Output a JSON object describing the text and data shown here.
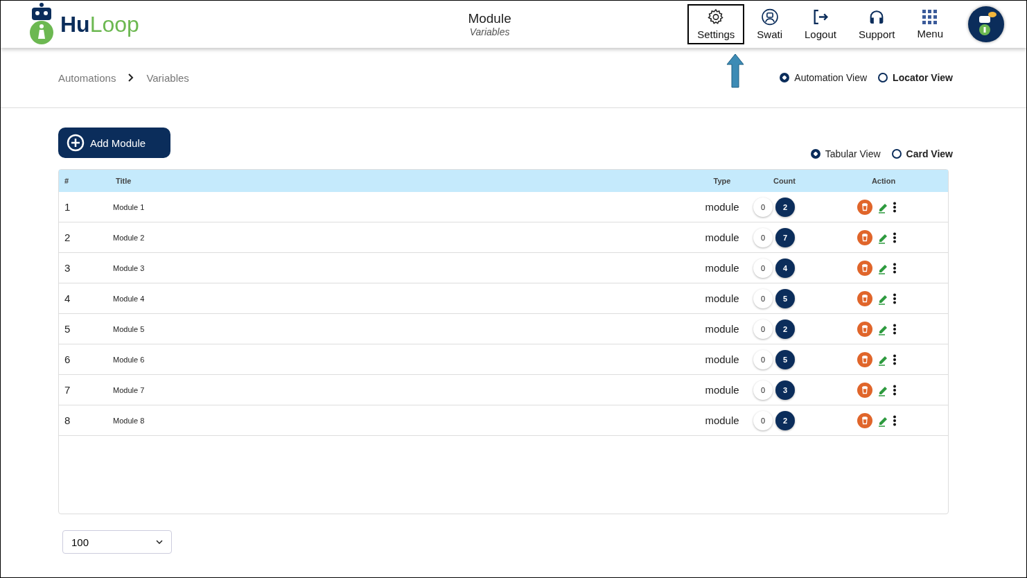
{
  "header": {
    "logo": {
      "dark": "Hu",
      "light": "Loop"
    },
    "title": "Module",
    "subtitle": "Variables",
    "nav": [
      {
        "label": "Settings",
        "kind": "gear",
        "highlighted": true
      },
      {
        "label": "Swati",
        "kind": "user",
        "highlighted": false
      },
      {
        "label": "Logout",
        "kind": "logout",
        "highlighted": false
      },
      {
        "label": "Support",
        "kind": "headset",
        "highlighted": false
      },
      {
        "label": "Menu",
        "kind": "grid",
        "highlighted": false
      }
    ]
  },
  "breadcrumb": [
    "Automations",
    "Variables"
  ],
  "view_modes": [
    {
      "label": "Automation View",
      "selected": true
    },
    {
      "label": "Locator View",
      "selected": false
    }
  ],
  "add_button": "Add Module",
  "layout_modes": [
    {
      "label": "Tabular View",
      "selected": true
    },
    {
      "label": "Card View",
      "selected": false
    }
  ],
  "table": {
    "columns": [
      "#",
      "Title",
      "Type",
      "Count",
      "Action"
    ],
    "rows": [
      {
        "index": "1",
        "title": "Module 1",
        "type": "module",
        "count_a": "0",
        "count_b": "2"
      },
      {
        "index": "2",
        "title": "Module 2",
        "type": "module",
        "count_a": "0",
        "count_b": "7"
      },
      {
        "index": "3",
        "title": "Module 3",
        "type": "module",
        "count_a": "0",
        "count_b": "4"
      },
      {
        "index": "4",
        "title": "Module 4",
        "type": "module",
        "count_a": "0",
        "count_b": "5"
      },
      {
        "index": "5",
        "title": "Module 5",
        "type": "module",
        "count_a": "0",
        "count_b": "2"
      },
      {
        "index": "6",
        "title": "Module 6",
        "type": "module",
        "count_a": "0",
        "count_b": "5"
      },
      {
        "index": "7",
        "title": "Module 7",
        "type": "module",
        "count_a": "0",
        "count_b": "3"
      },
      {
        "index": "8",
        "title": "Module 8",
        "type": "module",
        "count_a": "0",
        "count_b": "2"
      }
    ]
  },
  "page_size": "100"
}
